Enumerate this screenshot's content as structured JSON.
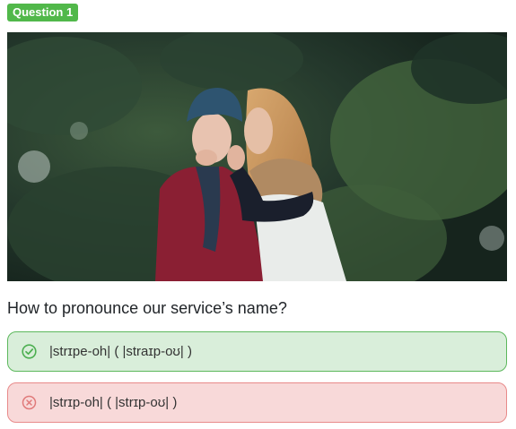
{
  "question_badge": "Question 1",
  "image": {
    "description_icon": "photo-two-women-whispering"
  },
  "question_text": "How to pronounce our service’s name?",
  "options": [
    {
      "label": "|strɪpe-oh| ( |straɪp-oʊ| )",
      "status": "correct",
      "icon": "check-circle-icon"
    },
    {
      "label": "|strɪp-oh| ( |strɪp-oʊ| )",
      "status": "incorrect",
      "icon": "x-circle-icon"
    }
  ],
  "colors": {
    "badge": "#51b84a",
    "correct_bg": "#d9eeda",
    "correct_border": "#5cb85c",
    "incorrect_bg": "#f8d9d9",
    "incorrect_border": "#e88a8a"
  }
}
